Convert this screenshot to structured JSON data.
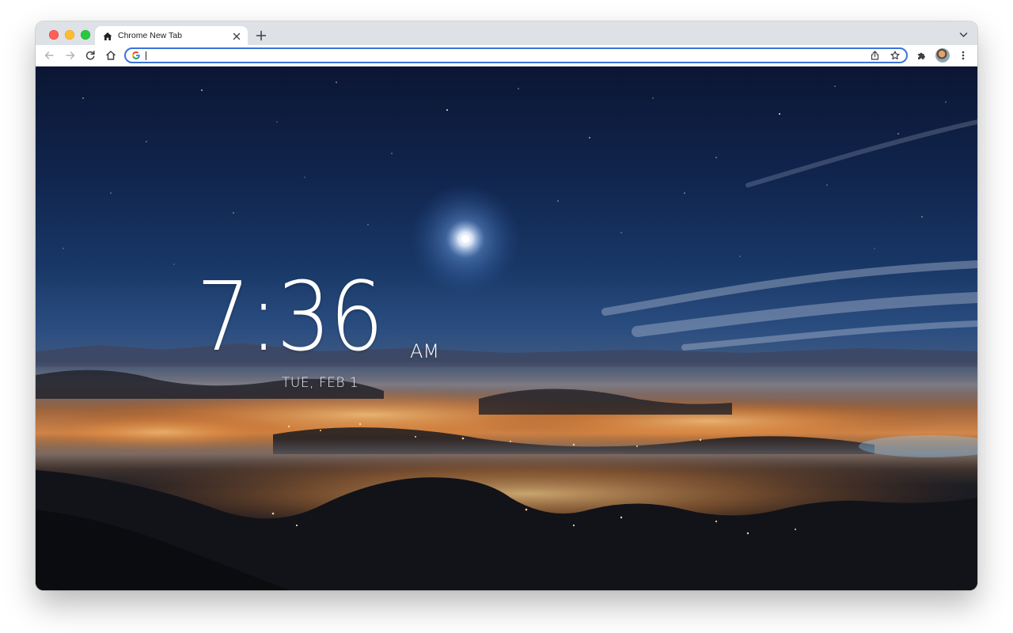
{
  "browser": {
    "tab": {
      "title": "Chrome New Tab",
      "favicon": "home-icon"
    },
    "toolbar": {
      "omnibox_value": "",
      "omnibox_engine_icon": "google-g-icon"
    },
    "colors": {
      "tabstrip": "#dee1e6",
      "omnibox_focus_ring": "#3b73d9"
    }
  },
  "new_tab_page": {
    "clock": {
      "time": "7:36",
      "ampm": "AM",
      "date": "TUE, FEB 1"
    },
    "background": "night sky over foggy valley with city lights"
  }
}
